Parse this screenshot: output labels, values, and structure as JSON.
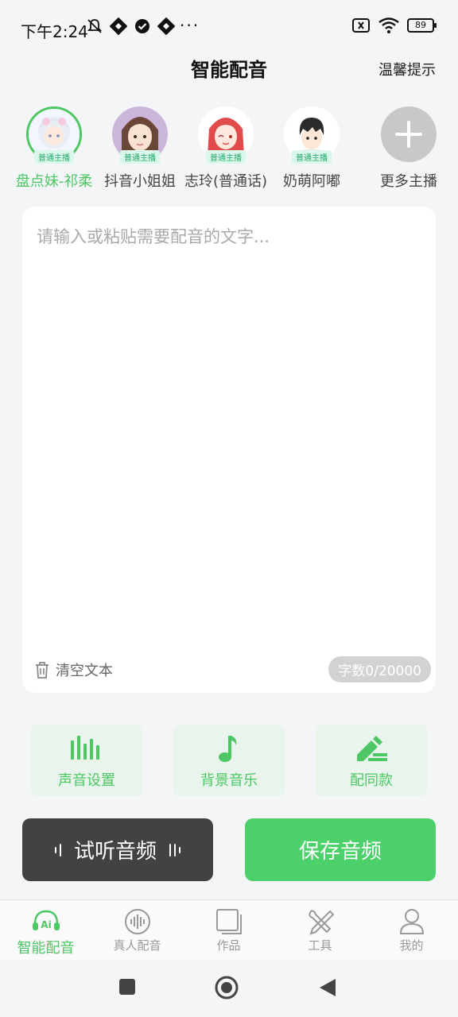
{
  "status_bar": {
    "time": "下午2:24",
    "dots": "···",
    "battery": "89"
  },
  "header": {
    "title": "智能配音",
    "tip": "温馨提示"
  },
  "anchors": [
    {
      "name": "盘点妹-祁柔",
      "tag": "普通主播",
      "selected": true
    },
    {
      "name": "抖音小姐姐",
      "tag": "普通主播",
      "selected": false
    },
    {
      "name": "志玲(普通话)",
      "tag": "普通主播",
      "selected": false
    },
    {
      "name": "奶萌阿嘟",
      "tag": "普通主播",
      "selected": false
    }
  ],
  "more_anchors": {
    "label": "更多主播"
  },
  "editor": {
    "placeholder": "请输入或粘贴需要配音的文字...",
    "value": "",
    "clear_label": "清空文本",
    "count": "字数0/20000"
  },
  "features": [
    {
      "label": "声音设置",
      "icon": "equalizer-icon"
    },
    {
      "label": "背景音乐",
      "icon": "music-note-icon"
    },
    {
      "label": "配同款",
      "icon": "edit-pen-icon"
    }
  ],
  "actions": {
    "preview": "试听音频",
    "save": "保存音频"
  },
  "bottom_nav": [
    {
      "label": "智能配音",
      "icon": "ai-headset-icon",
      "active": true
    },
    {
      "label": "真人配音",
      "icon": "voice-wave-icon",
      "active": false
    },
    {
      "label": "作品",
      "icon": "works-icon",
      "active": false
    },
    {
      "label": "工具",
      "icon": "tools-icon",
      "active": false
    },
    {
      "label": "我的",
      "icon": "user-icon",
      "active": false
    }
  ],
  "colors": {
    "accent": "#4cc764",
    "save_button": "#4cd16a",
    "preview_button": "#444241",
    "background": "#f4f5f7"
  }
}
